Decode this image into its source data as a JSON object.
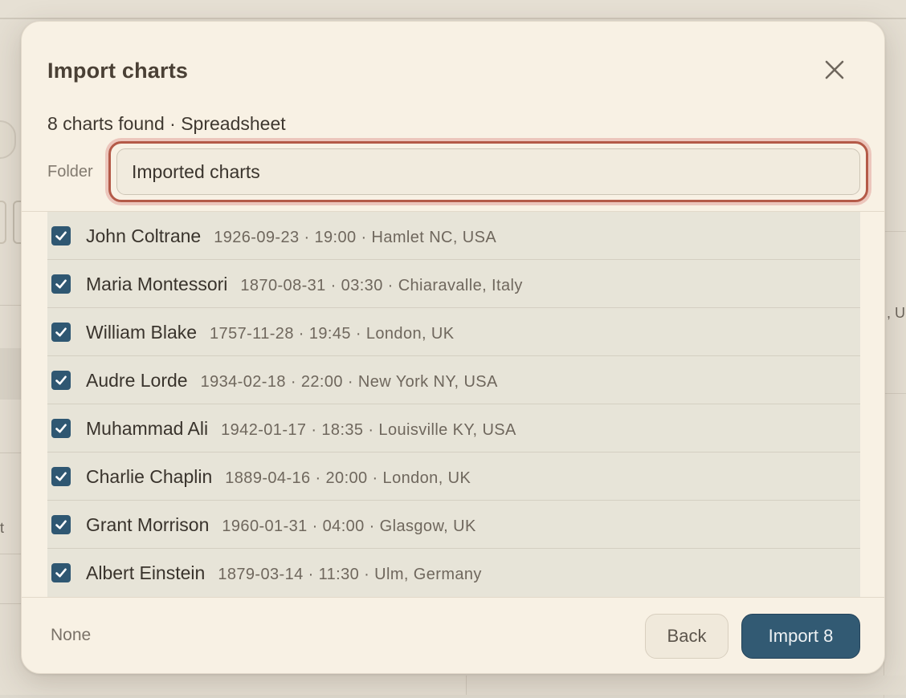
{
  "dialog": {
    "title": "Import charts",
    "summary": "8 charts found · Spreadsheet",
    "folder_label": "Folder",
    "folder_value": "Imported charts",
    "rows": [
      {
        "name": "John Coltrane",
        "details": "1926-09-23 · 19:00 · Hamlet NC, USA",
        "checked": true
      },
      {
        "name": "Maria Montessori",
        "details": "1870-08-31 · 03:30 · Chiaravalle, Italy",
        "checked": true
      },
      {
        "name": "William Blake",
        "details": "1757-11-28 · 19:45 · London, UK",
        "checked": true
      },
      {
        "name": "Audre Lorde",
        "details": "1934-02-18 · 22:00 · New York NY, USA",
        "checked": true
      },
      {
        "name": "Muhammad Ali",
        "details": "1942-01-17 · 18:35 · Louisville KY, USA",
        "checked": true
      },
      {
        "name": "Charlie Chaplin",
        "details": "1889-04-16 · 20:00 · London, UK",
        "checked": true
      },
      {
        "name": "Grant Morrison",
        "details": "1960-01-31 · 04:00 · Glasgow, UK",
        "checked": true
      },
      {
        "name": "Albert Einstein",
        "details": "1879-03-14 · 11:30 · Ulm, Germany",
        "checked": true
      }
    ],
    "footer": {
      "none_label": "None",
      "back_label": "Back",
      "import_label": "Import 8"
    }
  },
  "background": {
    "right_fragment": ", U",
    "left_fragment": "t"
  },
  "colors": {
    "accent": "#325a73",
    "focus_ring": "#b45a48",
    "dialog_bg": "#f8f1e4",
    "list_bg": "#e7e4d8"
  },
  "icons": {
    "close": "close-icon",
    "checkbox": "checkmark-icon"
  }
}
